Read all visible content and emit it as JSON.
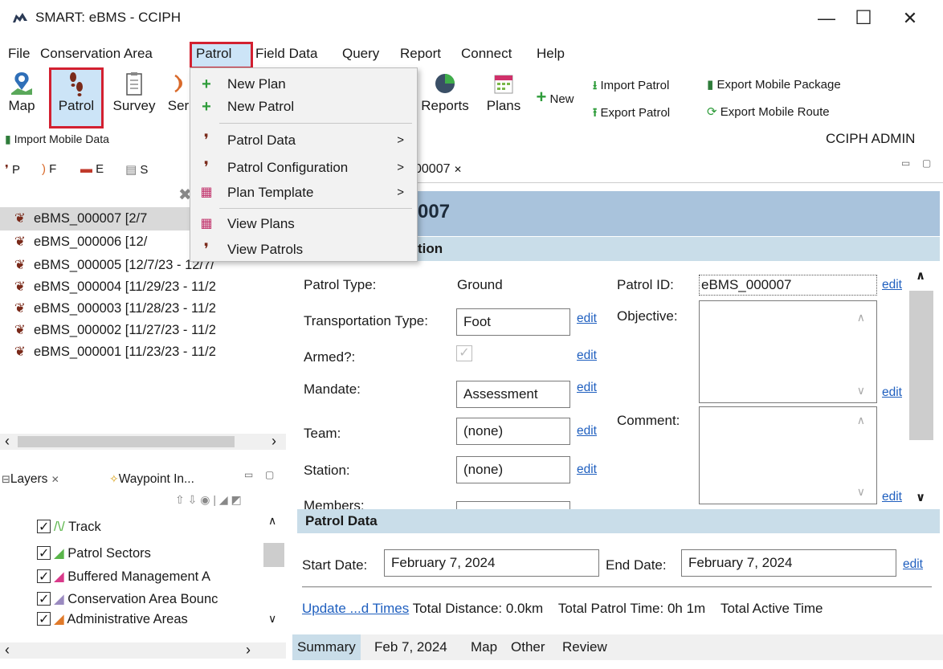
{
  "window": {
    "title": "SMART: eBMS - CCIPH",
    "minimize_glyph": "—",
    "maximize_glyph": "☐",
    "close_glyph": "✕"
  },
  "menubar": [
    "File",
    "Conservation Area",
    "Patrol",
    "Field Data",
    "Query",
    "Report",
    "Connect",
    "Help"
  ],
  "toolbar": {
    "map": "Map",
    "patrol": "Patrol",
    "survey": "Survey",
    "ser": "Ser",
    "reports": "Reports",
    "plans": "Plans",
    "new": "New",
    "import_patrol": "Import Patrol",
    "export_patrol": "Export Patrol",
    "export_mobile_package": "Export Mobile Package",
    "export_mobile_route": "Export Mobile Route",
    "import_mobile_data": "Import Mobile Data",
    "user": "CCIPH ADMIN"
  },
  "left_tabs": [
    "P",
    "F",
    "E",
    "S"
  ],
  "patrols": [
    {
      "id": "eBMS_000007",
      "range": "[2/7"
    },
    {
      "id": "eBMS_000006",
      "range": "[12/"
    },
    {
      "id": "eBMS_000005",
      "range": "[12/7/23 - 12/7/"
    },
    {
      "id": "eBMS_000004",
      "range": "[11/29/23 - 11/2"
    },
    {
      "id": "eBMS_000003",
      "range": "[11/28/23 - 11/2"
    },
    {
      "id": "eBMS_000002",
      "range": "[11/27/23 - 11/2"
    },
    {
      "id": "eBMS_000001",
      "range": "[11/23/23 - 11/2"
    }
  ],
  "layers_panel": {
    "tab_layers": "Layers",
    "tab_waypoint": "Waypoint In...",
    "layers": [
      "Track",
      "Patrol Sectors",
      "Buffered Management A",
      "Conservation Area Bounc",
      "Administrative Areas"
    ]
  },
  "patrol_menu": {
    "items": [
      "New Plan",
      "New Patrol",
      "Patrol Data",
      "Patrol Configuration",
      "Plan Template",
      "View Plans",
      "View Patrols"
    ]
  },
  "editor": {
    "tab_label": "00007",
    "title": "007",
    "section_info": "tion",
    "patrol_type_label": "Patrol Type:",
    "patrol_type_value": "Ground",
    "transport_label": "Transportation Type:",
    "transport_value": "Foot",
    "armed_label": "Armed?:",
    "mandate_label": "Mandate:",
    "mandate_value": "Assessment",
    "team_label": "Team:",
    "team_value": "(none)",
    "station_label": "Station:",
    "station_value": "(none)",
    "members_label": "Members:",
    "patrol_id_label": "Patrol ID:",
    "patrol_id_value": "eBMS_000007",
    "objective_label": "Objective:",
    "comment_label": "Comment:",
    "edit": "edit",
    "section_data": "Patrol Data",
    "start_label": "Start Date:",
    "start_value": "February 7, 2024",
    "end_label": "End Date:",
    "end_value": "February 7, 2024",
    "update_times": "Update ...d Times",
    "total_distance": "Total Distance: 0.0km",
    "total_patrol_time": "Total Patrol Time: 0h 1m",
    "total_active_time": "Total Active Time"
  },
  "bottom_tabs": [
    "Summary",
    "Feb 7, 2024",
    "Map",
    "Other",
    "Review"
  ],
  "colors": {
    "highlight_red": "#d32030",
    "selected_blue": "#cce4f7",
    "header_blue": "#a9c3dc",
    "section_blue": "#c9dde9",
    "link": "#1f5fbf"
  }
}
